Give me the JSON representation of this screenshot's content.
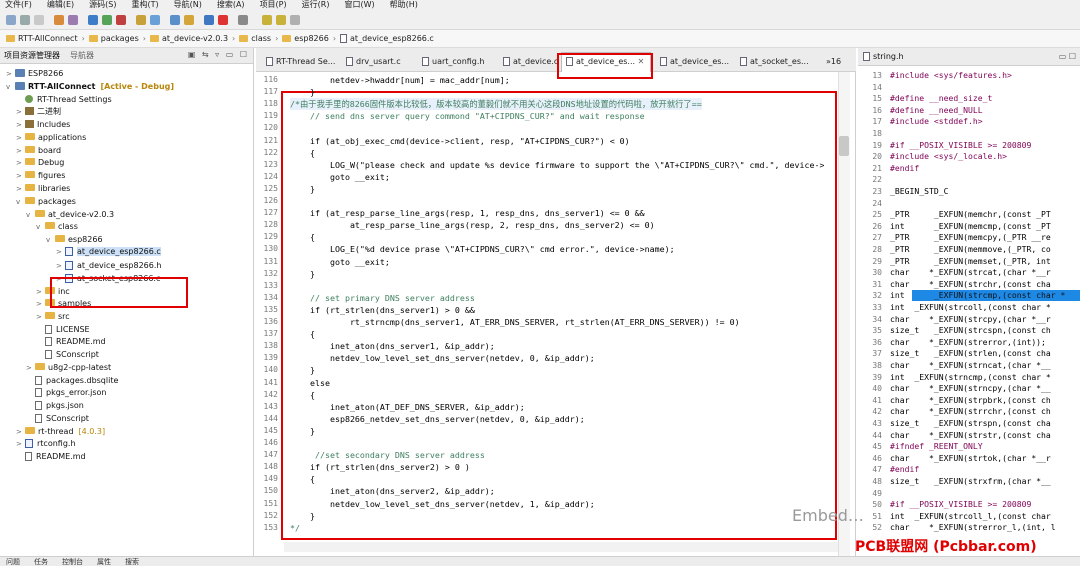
{
  "menubar": [
    "文件(F)",
    "编辑(E)",
    "源码(S)",
    "重构(T)",
    "导航(N)",
    "搜索(A)",
    "项目(P)",
    "运行(R)",
    "窗口(W)",
    "帮助(H)"
  ],
  "breadcrumb": [
    "RTT-AllConnect",
    "packages",
    "at_device-v2.0.3",
    "class",
    "esp8266",
    "at_device_esp8266.c"
  ],
  "left_panel": {
    "tabs": [
      "项目资源管理器",
      "导航器"
    ],
    "tree": [
      {
        "label": "ESP8266",
        "icon": "project-icon",
        "depth": 0,
        "toggle": ">"
      },
      {
        "label": "RTT-AllConnect",
        "suffix": "[Active - Debug]",
        "icon": "project-icon",
        "depth": 0,
        "toggle": "v"
      },
      {
        "label": "RT-Thread Settings",
        "icon": "settings-icon",
        "depth": 1,
        "toggle": ""
      },
      {
        "label": "二进制",
        "icon": "binary-icon",
        "depth": 1,
        "toggle": ">"
      },
      {
        "label": "Includes",
        "icon": "includes-icon",
        "depth": 1,
        "toggle": ">"
      },
      {
        "label": "applications",
        "icon": "folder-icon",
        "depth": 1,
        "toggle": ">"
      },
      {
        "label": "board",
        "icon": "folder-icon",
        "depth": 1,
        "toggle": ">"
      },
      {
        "label": "Debug",
        "icon": "folder-icon",
        "depth": 1,
        "toggle": ">"
      },
      {
        "label": "figures",
        "icon": "folder-icon",
        "depth": 1,
        "toggle": ">"
      },
      {
        "label": "libraries",
        "icon": "folder-icon",
        "depth": 1,
        "toggle": ">"
      },
      {
        "label": "packages",
        "icon": "folder-icon",
        "depth": 1,
        "toggle": "v"
      },
      {
        "label": "at_device-v2.0.3",
        "icon": "folder-icon",
        "depth": 2,
        "toggle": "v"
      },
      {
        "label": "class",
        "icon": "folder-icon",
        "depth": 3,
        "toggle": "v"
      },
      {
        "label": "esp8266",
        "icon": "folder-icon",
        "depth": 4,
        "toggle": "v"
      },
      {
        "label": "at_device_esp8266.c",
        "icon": "c-file-icon",
        "depth": 5,
        "toggle": ">",
        "selected": true
      },
      {
        "label": "at_device_esp8266.h",
        "icon": "h-file-icon",
        "depth": 5,
        "toggle": ">"
      },
      {
        "label": "at_socket_esp8266.c",
        "icon": "c-file-icon",
        "depth": 5,
        "toggle": ">"
      },
      {
        "label": "inc",
        "icon": "folder-icon",
        "depth": 3,
        "toggle": ">"
      },
      {
        "label": "samples",
        "icon": "folder-icon",
        "depth": 3,
        "toggle": ">"
      },
      {
        "label": "src",
        "icon": "folder-icon",
        "depth": 3,
        "toggle": ">"
      },
      {
        "label": "LICENSE",
        "icon": "file-icon",
        "depth": 3,
        "toggle": ""
      },
      {
        "label": "README.md",
        "icon": "file-icon",
        "depth": 3,
        "toggle": ""
      },
      {
        "label": "SConscript",
        "icon": "file-icon",
        "depth": 3,
        "toggle": ""
      },
      {
        "label": "u8g2-cpp-latest",
        "icon": "folder-icon",
        "depth": 2,
        "toggle": ">"
      },
      {
        "label": "packages.dbsqlite",
        "icon": "file-icon",
        "depth": 2,
        "toggle": ""
      },
      {
        "label": "pkgs_error.json",
        "icon": "file-icon",
        "depth": 2,
        "toggle": ""
      },
      {
        "label": "pkgs.json",
        "icon": "file-icon",
        "depth": 2,
        "toggle": ""
      },
      {
        "label": "SConscript",
        "icon": "file-icon",
        "depth": 2,
        "toggle": ""
      },
      {
        "label": "rt-thread",
        "suffix": "[4.0.3]",
        "icon": "folder-icon",
        "depth": 1,
        "toggle": ">"
      },
      {
        "label": "rtconfig.h",
        "icon": "h-file-icon",
        "depth": 1,
        "toggle": ">"
      },
      {
        "label": "README.md",
        "icon": "file-icon",
        "depth": 1,
        "toggle": ""
      }
    ]
  },
  "editor": {
    "tabs": [
      "RT-Thread Se...",
      "drv_usart.c",
      "uart_config.h",
      "at_device.c",
      "at_device_es...",
      "at_device_es...",
      "at_socket_es...",
      "»16"
    ],
    "active_tab_index": 4,
    "lines": [
      {
        "n": "116",
        "code": "        netdev->hwaddr[num] = mac_addr[num];",
        "kind": "code"
      },
      {
        "n": "117",
        "code": "    }",
        "kind": "code"
      },
      {
        "n": "118",
        "code": "/*由于我手里的8266固件版本比较低，版本较高的董毅们就不用关心这段DNS地址设置的代码啦，放开就行了==",
        "kind": "comment"
      },
      {
        "n": "119",
        "code": "    // send dns server query commond \"AT+CIPDNS_CUR?\" and wait response",
        "kind": "comment"
      },
      {
        "n": "120",
        "code": "",
        "kind": "code"
      },
      {
        "n": "121",
        "code": "    if (at_obj_exec_cmd(device->client, resp, \"AT+CIPDNS_CUR?\") < 0)",
        "kind": "code"
      },
      {
        "n": "122",
        "code": "    {",
        "kind": "code"
      },
      {
        "n": "123",
        "code": "        LOG_W(\"please check and update %s device firmware to support the \\\"AT+CIPDNS_CUR?\\\" cmd.\", device->",
        "kind": "code"
      },
      {
        "n": "124",
        "code": "        goto __exit;",
        "kind": "code"
      },
      {
        "n": "125",
        "code": "    }",
        "kind": "code"
      },
      {
        "n": "126",
        "code": "",
        "kind": "code"
      },
      {
        "n": "127",
        "code": "    if (at_resp_parse_line_args(resp, 1, resp_dns, dns_server1) <= 0 &&",
        "kind": "code"
      },
      {
        "n": "128",
        "code": "            at_resp_parse_line_args(resp, 2, resp_dns, dns_server2) <= 0)",
        "kind": "code"
      },
      {
        "n": "129",
        "code": "    {",
        "kind": "code"
      },
      {
        "n": "130",
        "code": "        LOG_E(\"%d device prase \\\"AT+CIPDNS_CUR?\\\" cmd error.\", device->name);",
        "kind": "code"
      },
      {
        "n": "131",
        "code": "        goto __exit;",
        "kind": "code"
      },
      {
        "n": "132",
        "code": "    }",
        "kind": "code"
      },
      {
        "n": "133",
        "code": "",
        "kind": "code"
      },
      {
        "n": "134",
        "code": "    // set primary DNS server address",
        "kind": "comment"
      },
      {
        "n": "135",
        "code": "    if (rt_strlen(dns_server1) > 0 &&",
        "kind": "code"
      },
      {
        "n": "136",
        "code": "            rt_strncmp(dns_server1, AT_ERR_DNS_SERVER, rt_strlen(AT_ERR_DNS_SERVER)) != 0)",
        "kind": "code"
      },
      {
        "n": "137",
        "code": "    {",
        "kind": "code"
      },
      {
        "n": "138",
        "code": "        inet_aton(dns_server1, &ip_addr);",
        "kind": "code"
      },
      {
        "n": "139",
        "code": "        netdev_low_level_set_dns_server(netdev, 0, &ip_addr);",
        "kind": "code"
      },
      {
        "n": "140",
        "code": "    }",
        "kind": "code"
      },
      {
        "n": "141",
        "code": "    else",
        "kind": "code"
      },
      {
        "n": "142",
        "code": "    {",
        "kind": "code"
      },
      {
        "n": "143",
        "code": "        inet_aton(AT_DEF_DNS_SERVER, &ip_addr);",
        "kind": "code"
      },
      {
        "n": "144",
        "code": "        esp8266_netdev_set_dns_server(netdev, 0, &ip_addr);",
        "kind": "code"
      },
      {
        "n": "145",
        "code": "    }",
        "kind": "code"
      },
      {
        "n": "146",
        "code": "",
        "kind": "code"
      },
      {
        "n": "147",
        "code": "     //set secondary DNS server address",
        "kind": "comment"
      },
      {
        "n": "148",
        "code": "    if (rt_strlen(dns_server2) > 0 )",
        "kind": "code"
      },
      {
        "n": "149",
        "code": "    {",
        "kind": "code"
      },
      {
        "n": "150",
        "code": "        inet_aton(dns_server2, &ip_addr);",
        "kind": "code"
      },
      {
        "n": "151",
        "code": "        netdev_low_level_set_dns_server(netdev, 1, &ip_addr);",
        "kind": "code"
      },
      {
        "n": "152",
        "code": "    }",
        "kind": "code"
      },
      {
        "n": "153",
        "code": "*/",
        "kind": "comment"
      }
    ]
  },
  "right_panel": {
    "tab": "string.h",
    "lines": [
      {
        "n": "13",
        "code": "#include <sys/features.h>"
      },
      {
        "n": "14",
        "code": ""
      },
      {
        "n": "15",
        "code": "#define __need_size_t"
      },
      {
        "n": "16",
        "code": "#define __need_NULL"
      },
      {
        "n": "17",
        "code": "#include <stddef.h>"
      },
      {
        "n": "18",
        "code": ""
      },
      {
        "n": "19",
        "code": "#if __POSIX_VISIBLE >= 200809"
      },
      {
        "n": "20",
        "code": "#include <sys/_locale.h>"
      },
      {
        "n": "21",
        "code": "#endif"
      },
      {
        "n": "22",
        "code": ""
      },
      {
        "n": "23",
        "code": "_BEGIN_STD_C"
      },
      {
        "n": "24",
        "code": ""
      },
      {
        "n": "25",
        "code": "_PTR     _EXFUN(memchr,(const _PT"
      },
      {
        "n": "26",
        "code": "int      _EXFUN(memcmp,(const _PT"
      },
      {
        "n": "27",
        "code": "_PTR     _EXFUN(memcpy,(_PTR __re"
      },
      {
        "n": "28",
        "code": "_PTR     _EXFUN(memmove,(_PTR, co"
      },
      {
        "n": "29",
        "code": "_PTR     _EXFUN(memset,(_PTR, int"
      },
      {
        "n": "30",
        "code": "char    *_EXFUN(strcat,(char *__r"
      },
      {
        "n": "31",
        "code": "char    *_EXFUN(strchr,(const cha"
      },
      {
        "n": "32",
        "code": "int      _EXFUN(strcmp,(const char *"
      },
      {
        "n": "33",
        "code": "int  _EXFUN(strcoll,(const char *"
      },
      {
        "n": "34",
        "code": "char    *_EXFUN(strcpy,(char *__r"
      },
      {
        "n": "35",
        "code": "size_t   _EXFUN(strcspn,(const ch"
      },
      {
        "n": "36",
        "code": "char    *_EXFUN(strerror,(int));"
      },
      {
        "n": "37",
        "code": "size_t   _EXFUN(strlen,(const cha"
      },
      {
        "n": "38",
        "code": "char    *_EXFUN(strncat,(char *__"
      },
      {
        "n": "39",
        "code": "int  _EXFUN(strncmp,(const char *"
      },
      {
        "n": "40",
        "code": "char    *_EXFUN(strncpy,(char *__"
      },
      {
        "n": "41",
        "code": "char    *_EXFUN(strpbrk,(const ch"
      },
      {
        "n": "42",
        "code": "char    *_EXFUN(strrchr,(const ch"
      },
      {
        "n": "43",
        "code": "size_t   _EXFUN(strspn,(const cha"
      },
      {
        "n": "44",
        "code": "char    *_EXFUN(strstr,(const cha"
      },
      {
        "n": "45",
        "code": "#ifndef _REENT_ONLY"
      },
      {
        "n": "46",
        "code": "char    *_EXFUN(strtok,(char *__r"
      },
      {
        "n": "47",
        "code": "#endif"
      },
      {
        "n": "48",
        "code": "size_t   _EXFUN(strxfrm,(char *__"
      },
      {
        "n": "49",
        "code": ""
      },
      {
        "n": "50",
        "code": "#if __POSIX_VISIBLE >= 200809"
      },
      {
        "n": "51",
        "code": "int  _EXFUN(strcoll_l,(const char"
      },
      {
        "n": "52",
        "code": "char    *_EXFUN(strerror_l,(int, l"
      }
    ],
    "selected_line_index": 19
  },
  "status_tabs": [
    "问题",
    "任务",
    "控制台",
    "属性",
    "搜索"
  ],
  "watermark": {
    "wechat": "Embed…",
    "site": "PCB联盟网 (Pcbbar.com)"
  },
  "colors": {
    "highlight_box": "#e00000",
    "comment": "#3f7f5f",
    "string": "#2a00ff",
    "keyword": "#7f0055",
    "selection": "#1e88e5"
  }
}
